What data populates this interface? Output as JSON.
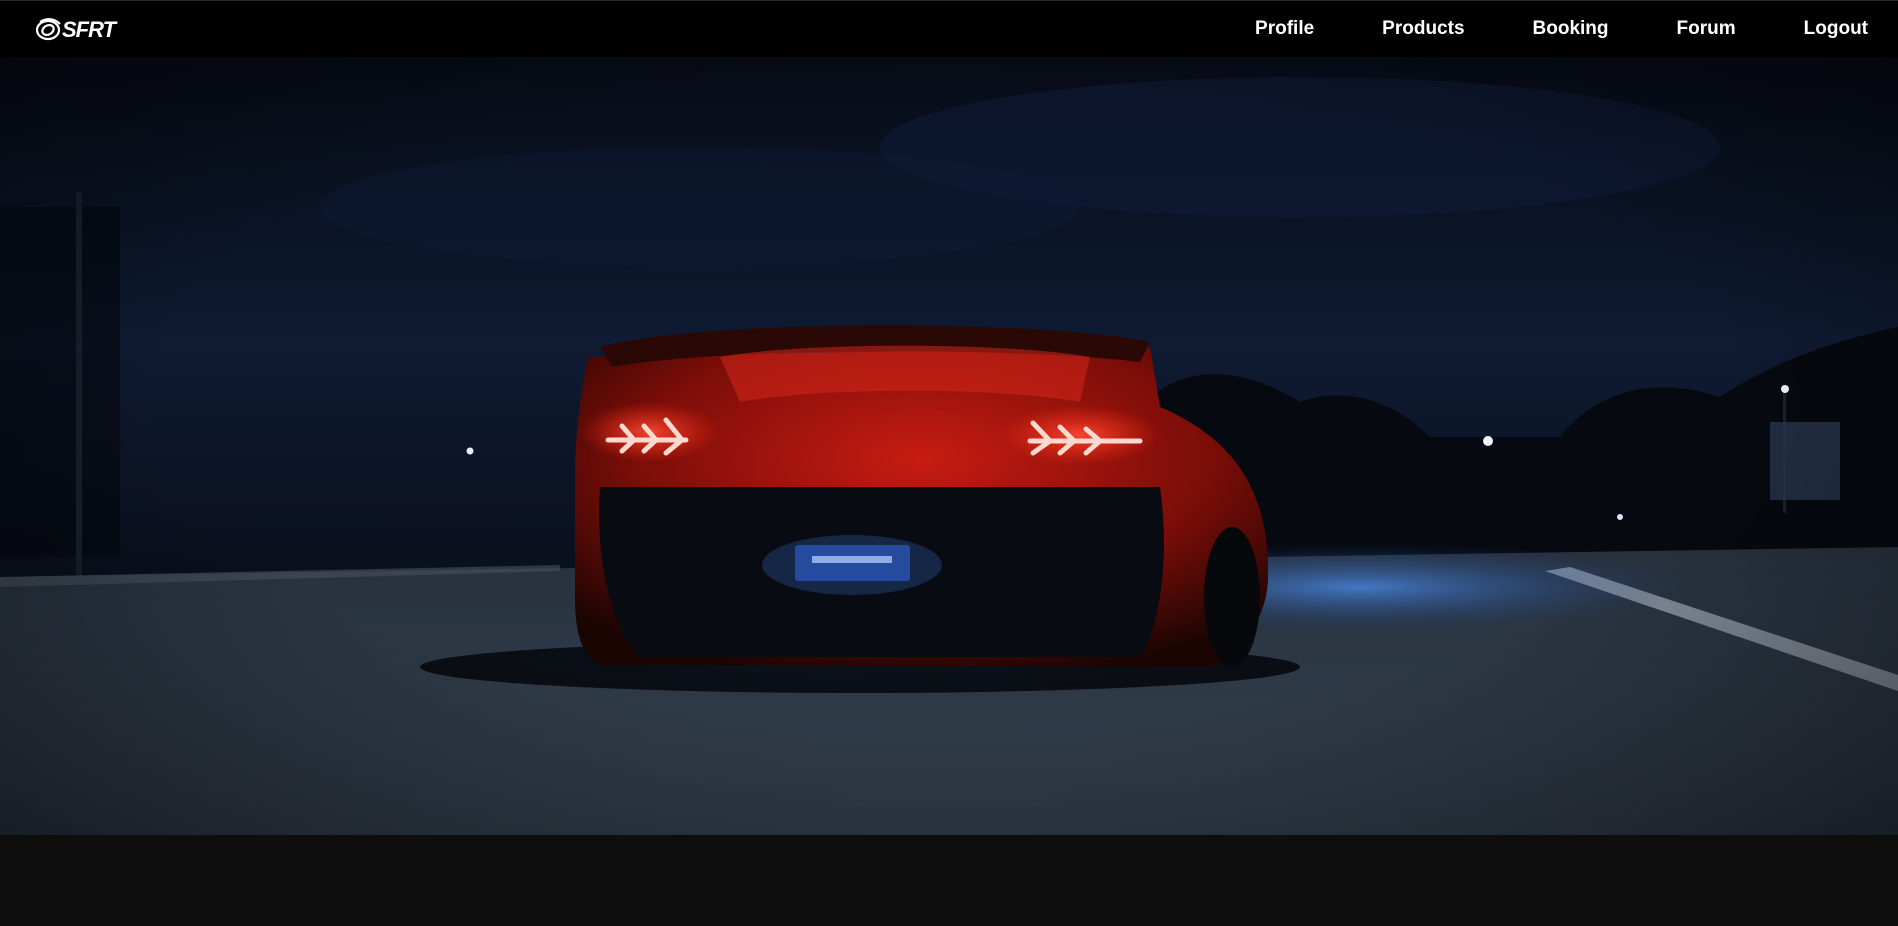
{
  "brand": {
    "logo_text": "SFRT",
    "logo_icon": "orbit-ring-logo-icon"
  },
  "nav": {
    "items": [
      {
        "label": "Profile"
      },
      {
        "label": "Products"
      },
      {
        "label": "Booking"
      },
      {
        "label": "Forum"
      },
      {
        "label": "Logout"
      }
    ]
  },
  "hero": {
    "image_subject": "supercar-rear-night-road",
    "palette": {
      "sky": "#0b1426",
      "road": "#2c3642",
      "car_body": "#b5170f",
      "tail_light": "#ff3b2b",
      "underglow": "#2f6fd6"
    }
  },
  "footer": {
    "background": "#0e0e0e"
  }
}
